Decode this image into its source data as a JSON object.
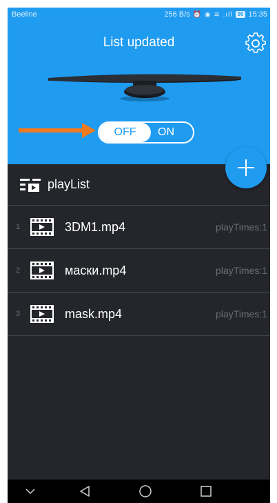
{
  "status_bar": {
    "carrier": "Beeline",
    "speed": "256 B/s",
    "icons": "⏰ ◉ ≋ .ıll",
    "battery": "90",
    "time": "15:35"
  },
  "header": {
    "title": "List updated",
    "settings_icon": "gear-icon",
    "toggle": {
      "off_label": "OFF",
      "on_label": "ON",
      "selected": "OFF"
    },
    "accent_color": "#1f9bf0",
    "arrow_color": "#f07a1e"
  },
  "fab": {
    "icon": "plus-icon"
  },
  "playlist": {
    "title": "playList",
    "items": [
      {
        "index": "1",
        "name": "3DM1.mp4",
        "plays": "playTimes:1"
      },
      {
        "index": "2",
        "name": "маски.mp4",
        "plays": "playTimes:1"
      },
      {
        "index": "3",
        "name": "mask.mp4",
        "plays": "playTimes:1"
      }
    ]
  },
  "nav_bar": {
    "buttons": [
      "chevron-down-icon",
      "back-icon",
      "home-icon",
      "recents-icon"
    ]
  }
}
